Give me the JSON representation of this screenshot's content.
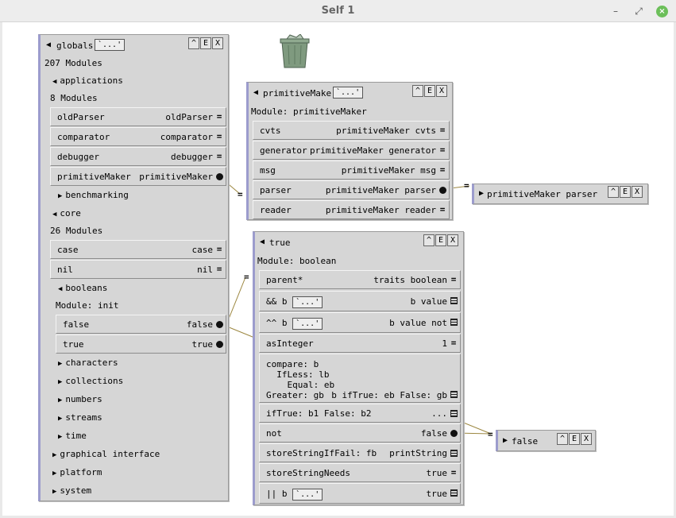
{
  "window": {
    "title": "Self 1",
    "minimize": "–",
    "restore": "⤢",
    "close": "×"
  },
  "header_buttons": {
    "collapse": "^",
    "edit": "E",
    "close": "X"
  },
  "dots": "`...'",
  "globals": {
    "title": "globals",
    "lines": {
      "modules_count": "207 Modules",
      "applications": "applications",
      "app_modules": "8 Modules",
      "benchmarking": "benchmarking",
      "core": "core",
      "core_modules": "26 Modules",
      "booleans": "booleans",
      "bool_module": "Module: init",
      "characters": "characters",
      "collections": "collections",
      "numbers": "numbers",
      "streams": "streams",
      "time": "time",
      "graphical": "graphical interface",
      "platform": "platform",
      "system": "system"
    },
    "app_slots": [
      {
        "name": "oldParser",
        "value": "oldParser"
      },
      {
        "name": "comparator",
        "value": "comparator"
      },
      {
        "name": "debugger",
        "value": "debugger"
      },
      {
        "name": "primitiveMaker",
        "value": "primitiveMaker"
      }
    ],
    "core_slots": [
      {
        "name": "case",
        "value": "case"
      },
      {
        "name": "nil",
        "value": "nil"
      }
    ],
    "bool_slots": [
      {
        "name": "false",
        "value": "false"
      },
      {
        "name": "true",
        "value": "true"
      }
    ]
  },
  "primitiveMaker": {
    "title": "primitiveMaker",
    "module": "Module: primitiveMaker",
    "slots": [
      {
        "name": "cvts",
        "value": "primitiveMaker cvts"
      },
      {
        "name": "generator",
        "value": "primitiveMaker generator"
      },
      {
        "name": "msg",
        "value": "primitiveMaker msg"
      },
      {
        "name": "parser",
        "value": "primitiveMaker parser"
      },
      {
        "name": "reader",
        "value": "primitiveMaker reader"
      }
    ]
  },
  "parser_outliner": {
    "title": "primitiveMaker parser"
  },
  "true_outliner": {
    "title": "true",
    "module": "Module: boolean",
    "slots": {
      "parent": {
        "name": "parent*",
        "value": "traits boolean"
      },
      "and": {
        "name": "&& b",
        "value": "b value"
      },
      "xor": {
        "name": "^^ b",
        "value": "b value not"
      },
      "asInteger": {
        "name": "asInteger",
        "value": "1"
      },
      "compare": {
        "line1": "compare: b",
        "line2": "IfLess: lb",
        "line3": "Equal: eb",
        "line4": "Greater: gb",
        "value": "b ifTrue: eb False: gb"
      },
      "iftrue": {
        "name": "ifTrue: b1 False: b2",
        "value": "..."
      },
      "not": {
        "name": "not",
        "value": "false"
      },
      "storeString": {
        "name": "storeStringIfFail: fb",
        "value": "printString"
      },
      "storeNeeds": {
        "name": "storeStringNeeds",
        "value": "true"
      },
      "or": {
        "name": "|| b",
        "value": "true"
      }
    }
  },
  "false_outliner": {
    "title": "false"
  },
  "icons": {
    "triangle_down": "◀",
    "triangle_right": "▶",
    "equals": "="
  }
}
